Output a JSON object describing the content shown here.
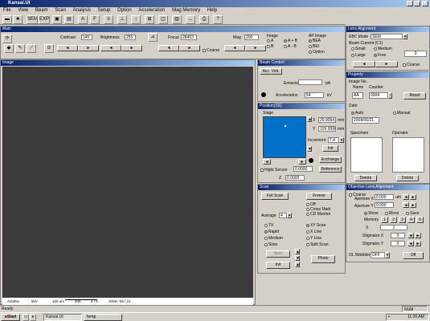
{
  "window": {
    "title": "Kansai.UI"
  },
  "menu": [
    "File",
    "View",
    "Beam",
    "Scan",
    "Analysis",
    "Setup",
    "Option",
    "Acceleration",
    "Mag Memory",
    "Help"
  ],
  "toolbar": {
    "sem_label": "SEM",
    "exp_label": "EXP"
  },
  "main_panel": {
    "title": "Main",
    "contrast_label": "Contrast",
    "contrast_value": "145",
    "brightness_label": "Brightness",
    "brightness_value": "255",
    "focus_label": "Focus",
    "focus_value": "28453",
    "mag_label": "Mag",
    "mag_value": "200",
    "coarse_label": "Coarse",
    "image_label": "Image",
    "image_opts": [
      "A",
      "B",
      "A + B",
      "A - B"
    ],
    "ap_label": "AP Image",
    "ap_opts": [
      "BEA",
      "BEI",
      "Option"
    ]
  },
  "image_panel": {
    "title": "Image",
    "info": [
      "Ax005x",
      "5kV",
      "100 um",
      "20K",
      "4 / 8",
      "2008 / 06 / 21"
    ]
  },
  "beam_control": {
    "title": "Beam Control",
    "tab": "Acc. Volt.",
    "emission_label": "Emission",
    "emission_unit": "pA",
    "accel_label": "Acceleration",
    "accel_value": "54",
    "accel_unit": "kV"
  },
  "position": {
    "title": "Position(SS)",
    "stage_label": "Stage",
    "x_label": "X",
    "x_value": "29.9054",
    "x_unit": "mm",
    "y_label": "Y",
    "y_value": "109.9996",
    "y_unit": "mm",
    "increment_label": "Increment",
    "increment_value": "7.4",
    "init_label": "Init",
    "exchange_label": "Exchange",
    "height_label": "Hight Sensor",
    "height_value": "0.0000",
    "reference_label": "Reference",
    "z_label": "Z",
    "z_value": "0.0000"
  },
  "scan": {
    "title": "Scan",
    "fullscan_label": "Full Scan",
    "freeze_label": "Freeze",
    "average_label": "Average",
    "average_value": "4",
    "mode_opts": [
      "Off",
      "Cross Mark",
      "CD Monitor"
    ],
    "speed_opts": [
      "TV",
      "Rapid",
      "Medium",
      "Slow"
    ],
    "line_opts": [
      "XY Scan",
      "X Line",
      "Y Line",
      "Split Scan"
    ],
    "spot_label": "Spot",
    "init_label": "Init",
    "photo_label": "Photo"
  },
  "lens_alignment": {
    "title": "Lens Alignment",
    "ebc_label": "EBC Mode",
    "ebc_value": "SEM",
    "beam_current_label": "Beam Current (C1)",
    "bc_opts": [
      "Small",
      "Medium",
      "Large",
      "Free"
    ],
    "bc_value": "0",
    "coarse_label": "Coarse"
  },
  "property": {
    "title": "Property",
    "image_no_label": "Image No.",
    "name_label": "Name",
    "counter_label": "Counter",
    "name_value": "AA",
    "counter_value": "0004",
    "reset_label": "Reset",
    "date_label": "Date",
    "auto_label": "Auto",
    "manual_label": "Manual",
    "date_value": "2008/06/21",
    "specimen_label": "Specimen",
    "operator_label": "Operator",
    "delete_label": "Delete",
    "delete2_label": "Delete"
  },
  "ol_alignment": {
    "title": "Objective Lens Alignment",
    "aperture_x_label": "Aperture X",
    "aperture_x_value": "0.000",
    "aperture_y_label": "Aperture Y",
    "aperture_y_value": "0.000",
    "aperture_unit": "um",
    "coarse_label": "Coarse",
    "show_label": "Show",
    "move_label": "Move",
    "save_label": "Save",
    "memory_label": "Memory",
    "memory_nums": [
      "1",
      "2",
      "3",
      "4",
      "5"
    ],
    "x_label": "X",
    "x_value": "1",
    "stig_x_label": "Stigmator X",
    "stig_x_value": "0",
    "stig_y_label": "Stigmator Y",
    "stig_y_value": "0",
    "wobbler_label": "OL Wobbler",
    "wobbler_value": "OFF",
    "off_label": "Off"
  },
  "statusbar": {
    "left": "Ready",
    "right": "NUM"
  },
  "taskbar": {
    "start": "Start",
    "task1": "Kansai.UI",
    "task2": "Temp",
    "clock": "11:26 AM"
  },
  "colors": {
    "titlebar": "#0a246a",
    "stage_blue": "#0070c8",
    "image_bg": "#3c3c3c"
  }
}
